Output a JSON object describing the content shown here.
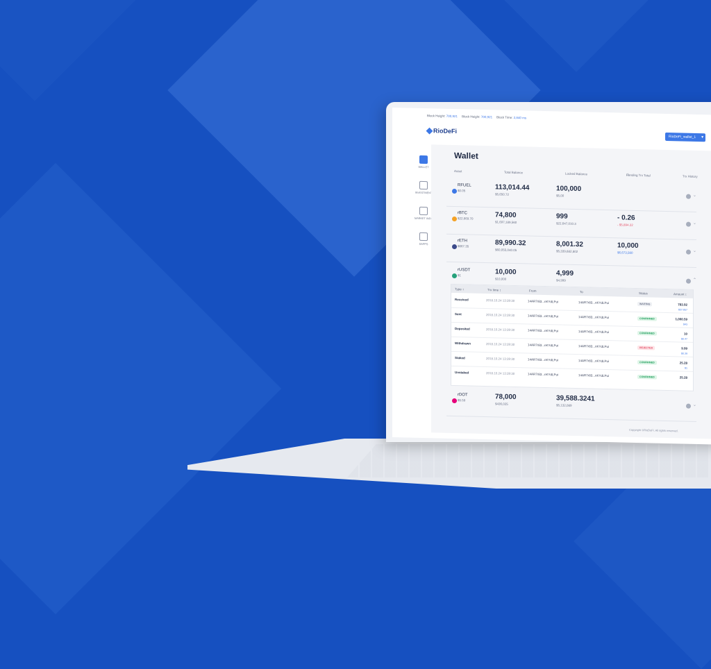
{
  "top_status": {
    "block_height_label": "Block Height:",
    "block_height_1": "700,921",
    "block_height_2": "700,921",
    "block_time_label": "Block Time:",
    "block_time": "2,840 ms"
  },
  "brand": {
    "logo_text": "RioDeFi"
  },
  "user": {
    "wallet_label": "RioDeFi_wallet_1"
  },
  "sidebar": {
    "items": [
      {
        "label": "WALLET"
      },
      {
        "label": "INVESTMENT"
      },
      {
        "label": "MARKET INFO"
      },
      {
        "label": "DAPPS"
      }
    ]
  },
  "page": {
    "title": "Wallet"
  },
  "columns": {
    "asset": "Asset",
    "total_balance": "Total Balance",
    "locked_balance": "Locked Balance",
    "pending": "Pending Trx Total",
    "history": "Trx History"
  },
  "assets": [
    {
      "name": "RFUEL",
      "price": "$0.05",
      "total": "113,014.44",
      "total_sub": "$5,650.72",
      "locked": "100,000",
      "locked_sub": "$5,00",
      "pending": "",
      "pending_sub": ""
    },
    {
      "name": "rBTC",
      "price": "$22,669.70",
      "total": "74,800",
      "total_sub": "$1,697,189,560",
      "locked": "999",
      "locked_sub": "$22,647,010.3",
      "pending": "- 0.26",
      "pending_sub": "- $5,894.22"
    },
    {
      "name": "rETH",
      "price": "$667.35",
      "total": "89,990.32",
      "total_sub": "$60,055,040.05",
      "locked": "8,001.32",
      "locked_sub": "$5,339,682,802",
      "pending": "10,000",
      "pending_sub": "$6,673,560"
    },
    {
      "name": "rUSDT",
      "price": "$1",
      "total": "10,000",
      "total_sub": "$10,000",
      "locked": "4,999",
      "locked_sub": "$4,999",
      "pending": "",
      "pending_sub": ""
    },
    {
      "name": "rDOT",
      "price": "$5.59",
      "total": "78,000",
      "total_sub": "$436,025",
      "locked": "39,588.3241",
      "locked_sub": "$5,132,089",
      "pending": "",
      "pending_sub": ""
    }
  ],
  "tx_headers": {
    "type": "Type ↕",
    "time": "Trx time ↕",
    "from": "From",
    "to": "To",
    "status": "Status",
    "amount": "Amount ↕"
  },
  "transactions": [
    {
      "type": "Received",
      "time": "2018.10.24 13:39:30",
      "from": "14AR7r83...nKYdLPui",
      "to": "14AR7r83...nKYdLPui",
      "status": "WAITING",
      "status_kind": "wait",
      "amount": "783.92",
      "amount_sub": "$37.857"
    },
    {
      "type": "Sent",
      "time": "2018.10.24 13:39:30",
      "from": "14AR7r83...nKYdLPui",
      "to": "14AR7r83...nKYdLPui",
      "status": "CONFIRMED",
      "status_kind": "conf",
      "amount": "1,000.59",
      "amount_sub": "$43"
    },
    {
      "type": "Deposited",
      "time": "2018.10.24 13:39:30",
      "from": "14AR7r83...nKYdLPui",
      "to": "14AR7r83...nKYdLPui",
      "status": "CONFIRMED",
      "status_kind": "conf",
      "amount": "10",
      "amount_sub": "$0.47"
    },
    {
      "type": "Withdrawn",
      "time": "2018.10.24 13:39:30",
      "from": "14AR7r83...nKYdLPui",
      "to": "14AR7r83...nKYdLPui",
      "status": "REJECTED",
      "status_kind": "rej",
      "amount": "9.99",
      "amount_sub": "$0.39"
    },
    {
      "type": "Staked",
      "time": "2018.10.24 13:39:30",
      "from": "14AR7r83...nKYdLPui",
      "to": "14AR7r83...nKYdLPui",
      "status": "CONFIRMED",
      "status_kind": "conf",
      "amount": "25.28",
      "amount_sub": "$1"
    },
    {
      "type": "Unstaked",
      "time": "2018.10.24 13:39:30",
      "from": "14AR7r83...nKYdLPui",
      "to": "14AR7r83...nKYdLPui",
      "status": "CONFIRMED",
      "status_kind": "conf",
      "amount": "25.28",
      "amount_sub": ""
    }
  ],
  "footer": {
    "copyright": "Copyright ©RioDeFi. All rights reserved."
  },
  "colors": {
    "background": "#1650c0",
    "accent": "#3d78e6",
    "confirmed": "#1f9e5c",
    "rejected": "#e5546b"
  }
}
